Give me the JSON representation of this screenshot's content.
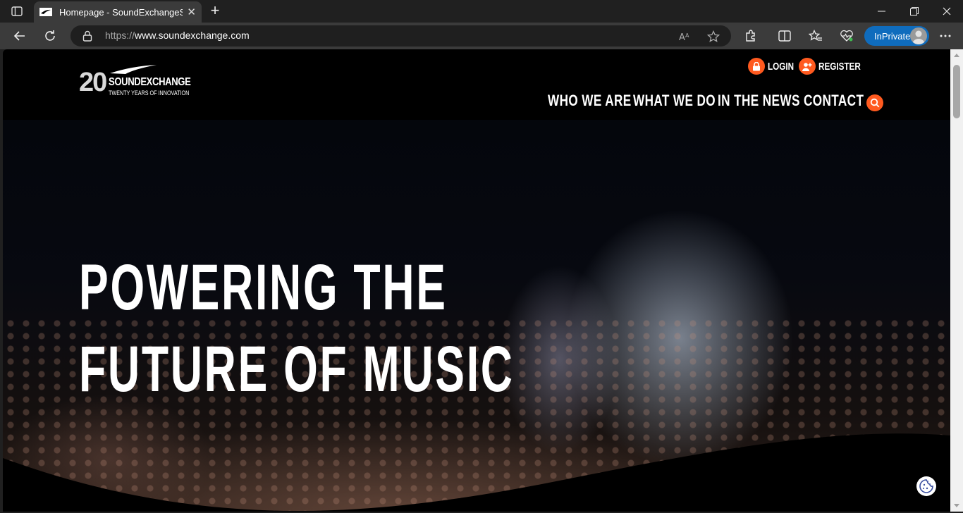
{
  "browser": {
    "tab": {
      "title": "Homepage - SoundExchangeSou",
      "close_glyph": "✕"
    },
    "new_tab_glyph": "+",
    "address": {
      "scheme": "https://",
      "host": "www.soundexchange.com"
    },
    "inprivate_label": "InPrivate"
  },
  "site": {
    "logo": {
      "number": "20",
      "brand": "SOUNDEXCHANGE",
      "tagline": "TWENTY YEARS OF INNOVATION"
    },
    "utility": {
      "login": "LOGIN",
      "register": "REGISTER"
    },
    "nav": [
      "WHO WE ARE",
      "WHAT WE DO",
      "IN THE NEWS",
      "CONTACT"
    ],
    "hero": {
      "line1": "POWERING THE",
      "line2": "FUTURE OF MUSIC"
    }
  },
  "colors": {
    "accent": "#ff5a1f",
    "browser_dark": "#202020",
    "browser_toolbar": "#3b3b3b",
    "inprivate": "#0f6cbd"
  }
}
